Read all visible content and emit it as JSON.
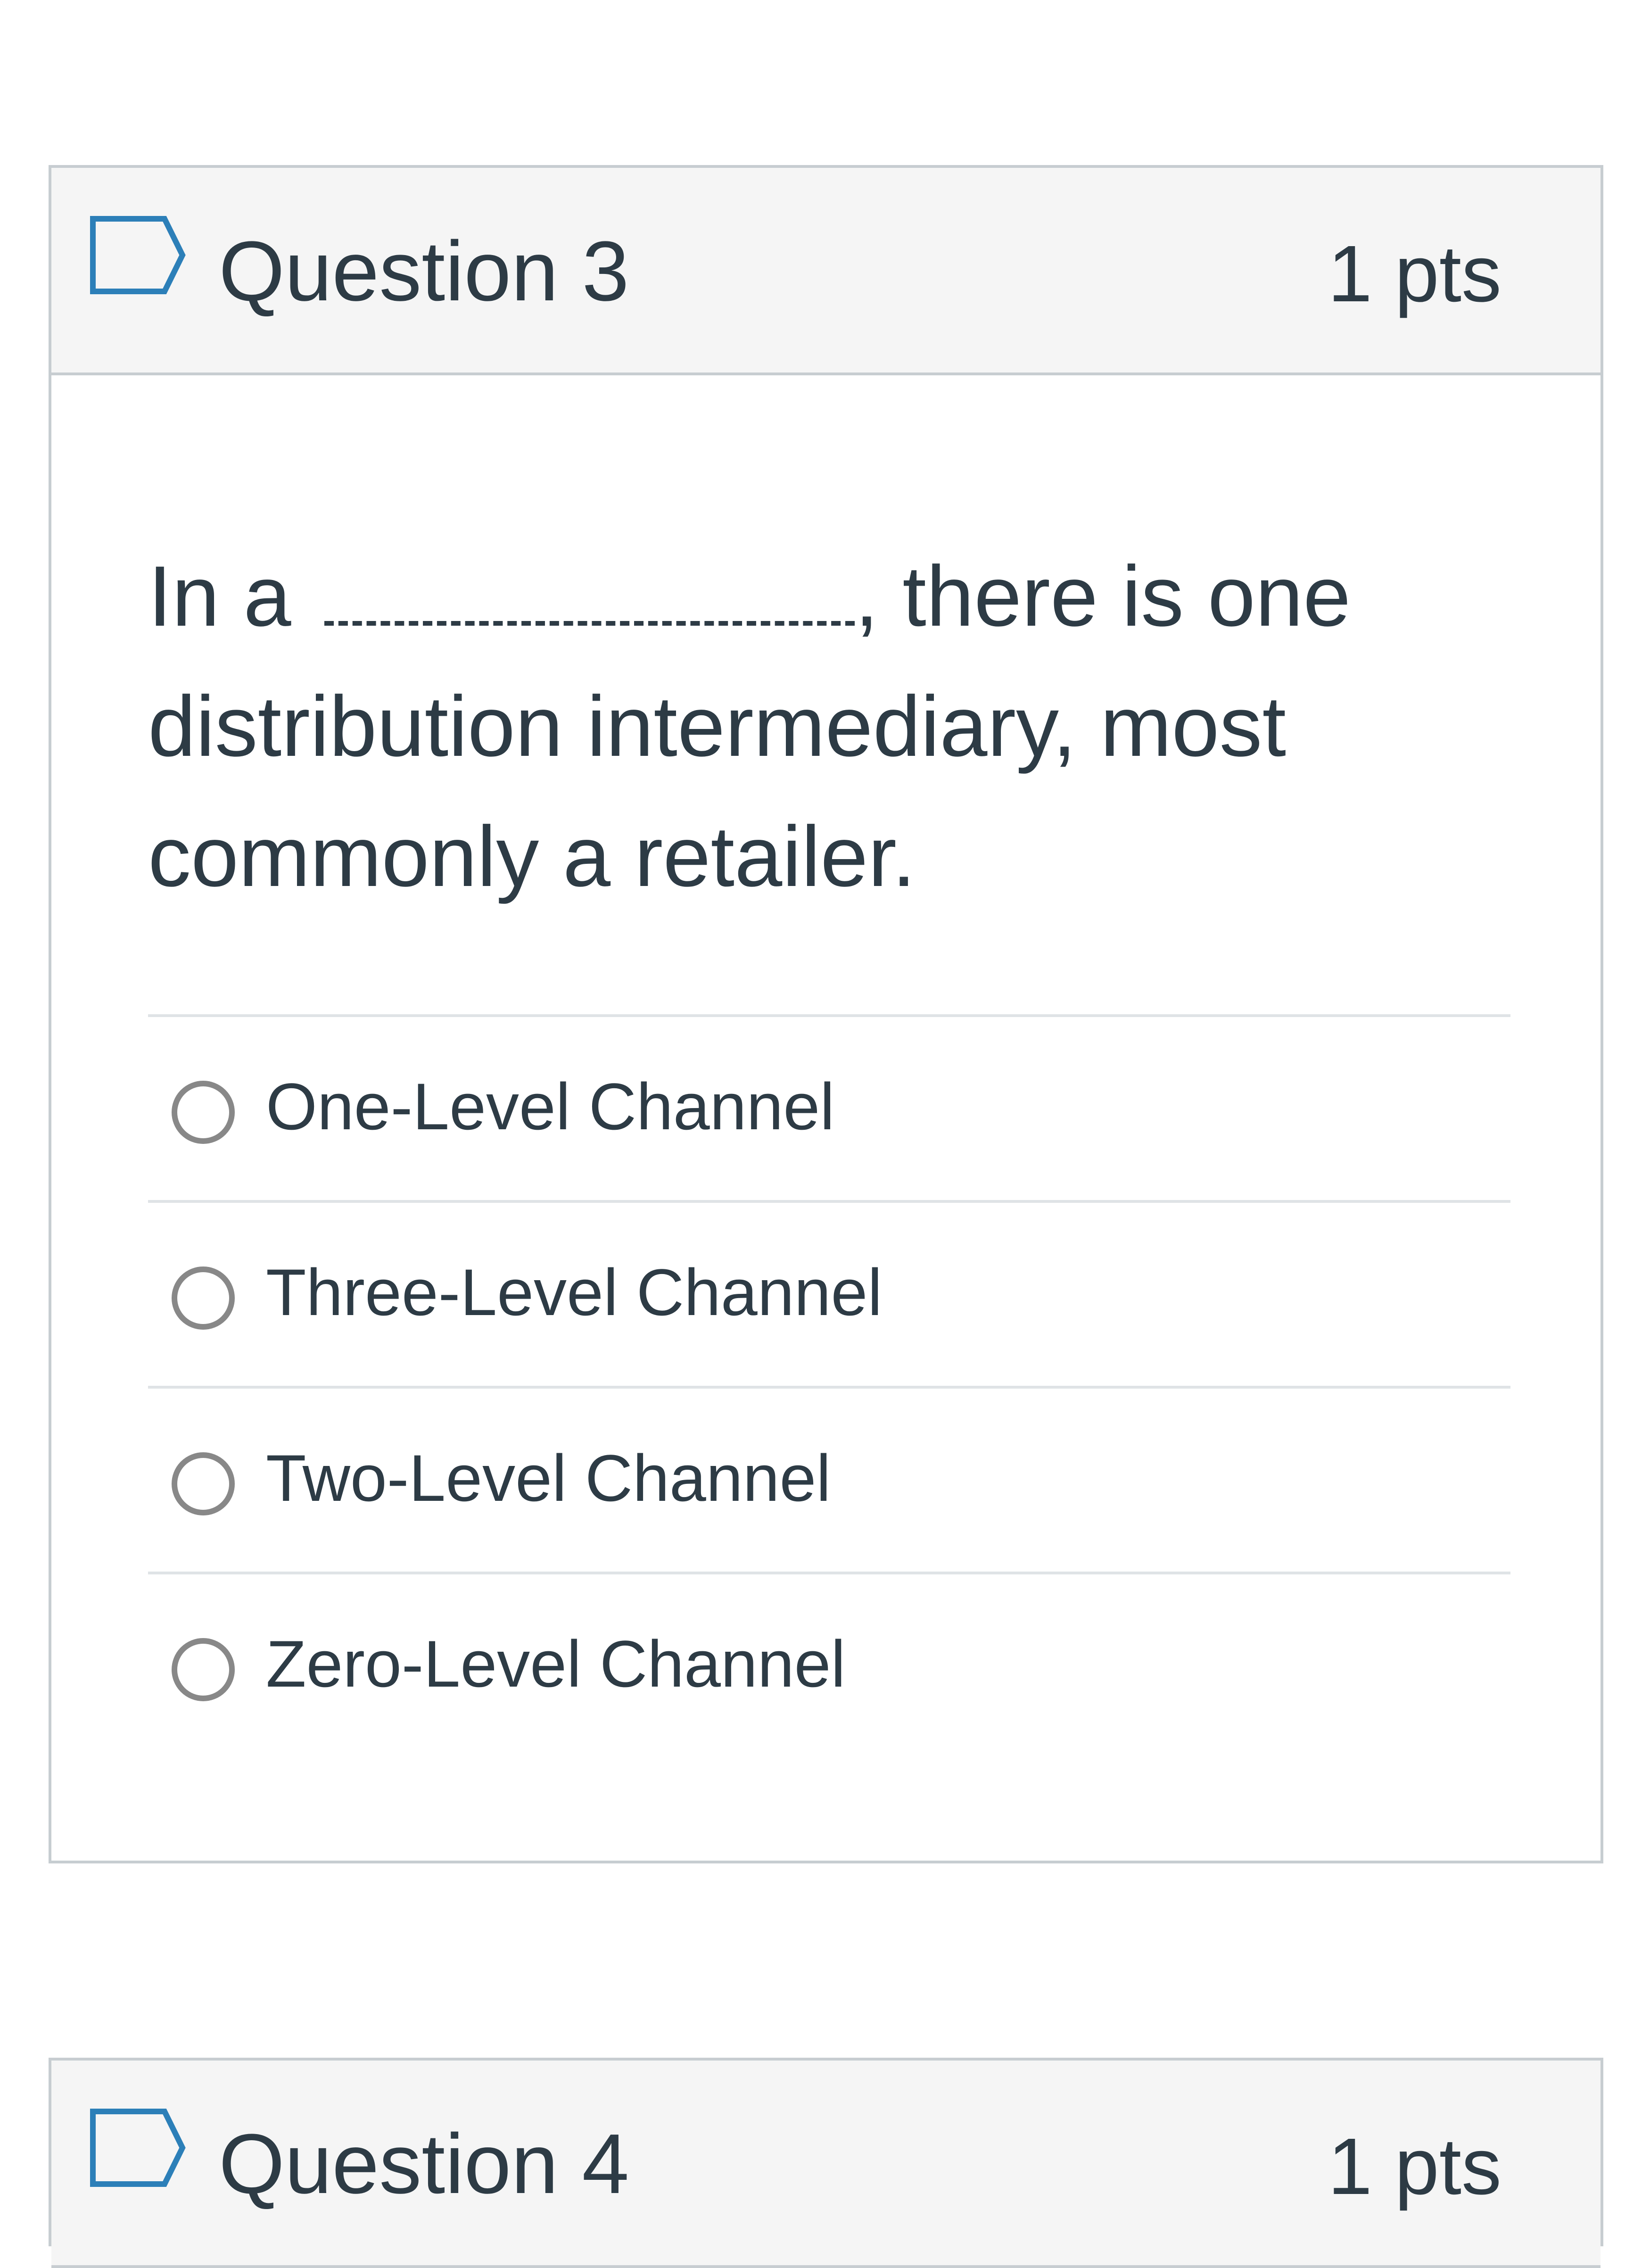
{
  "question3": {
    "title": "Question 3",
    "points": "1 pts",
    "text_before": "In a",
    "text_after": ", there is one distribution intermediary, most commonly a retailer.",
    "answers": [
      {
        "label": "One-Level Channel"
      },
      {
        "label": "Three-Level Channel"
      },
      {
        "label": "Two-Level Channel"
      },
      {
        "label": "Zero-Level Channel"
      }
    ]
  },
  "question4": {
    "title": "Question 4",
    "points": "1 pts"
  },
  "colors": {
    "header_bg": "#f5f5f5",
    "border": "#c7cdd1",
    "text": "#2d3b45",
    "radio_border": "#888888"
  },
  "icons": {
    "flag": "flag-question-icon"
  }
}
